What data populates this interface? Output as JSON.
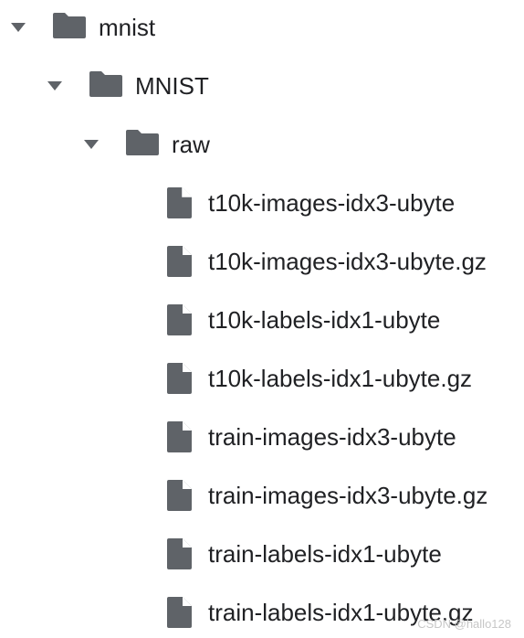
{
  "tree": {
    "root": {
      "label": "mnist",
      "icon": "folder-icon",
      "expanded": true
    },
    "child": {
      "label": "MNIST",
      "icon": "folder-icon",
      "expanded": true
    },
    "grandchild": {
      "label": "raw",
      "icon": "folder-icon",
      "expanded": true
    },
    "files": [
      {
        "label": "t10k-images-idx3-ubyte",
        "icon": "file-icon"
      },
      {
        "label": "t10k-images-idx3-ubyte.gz",
        "icon": "file-icon"
      },
      {
        "label": "t10k-labels-idx1-ubyte",
        "icon": "file-icon"
      },
      {
        "label": "t10k-labels-idx1-ubyte.gz",
        "icon": "file-icon"
      },
      {
        "label": "train-images-idx3-ubyte",
        "icon": "file-icon"
      },
      {
        "label": "train-images-idx3-ubyte.gz",
        "icon": "file-icon"
      },
      {
        "label": "train-labels-idx1-ubyte",
        "icon": "file-icon"
      },
      {
        "label": "train-labels-idx1-ubyte.gz",
        "icon": "file-icon"
      }
    ]
  },
  "watermark": "CSDN @hallo128",
  "colors": {
    "icon": "#5f6368",
    "text": "#202124"
  }
}
